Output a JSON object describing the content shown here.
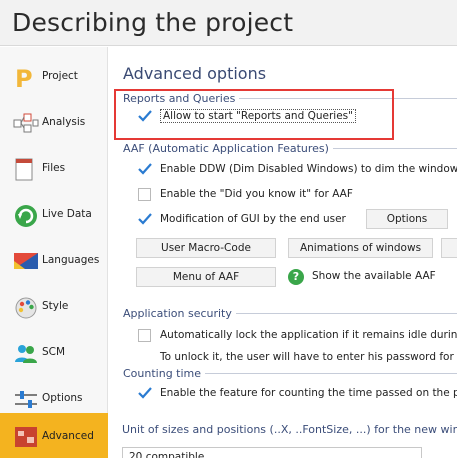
{
  "window": {
    "title": "Describing the project"
  },
  "sidebar": {
    "items": [
      {
        "label": "Project",
        "icon": "project-p-icon",
        "active": false
      },
      {
        "label": "Analysis",
        "icon": "analysis-icon",
        "active": false
      },
      {
        "label": "Files",
        "icon": "files-icon",
        "active": false
      },
      {
        "label": "Live Data",
        "icon": "live-data-icon",
        "active": false
      },
      {
        "label": "Languages",
        "icon": "languages-flag-icon",
        "active": false
      },
      {
        "label": "Style",
        "icon": "style-palette-icon",
        "active": false
      },
      {
        "label": "SCM",
        "icon": "scm-users-icon",
        "active": false
      },
      {
        "label": "Options",
        "icon": "options-sliders-icon",
        "active": false
      },
      {
        "label": "Advanced",
        "icon": "advanced-icon",
        "active": true
      }
    ]
  },
  "main": {
    "heading": "Advanced options",
    "reports": {
      "title": "Reports and Queries",
      "allow_label": "Allow to start \"Reports and Queries\"",
      "allow_checked": true
    },
    "aaf": {
      "title": "AAF (Automatic Application Features)",
      "ddw_label": "Enable DDW (Dim Disabled Windows) to dim  the windows when",
      "ddw_checked": true,
      "did_you_know_label": "Enable the \"Did you know it\" for AAF",
      "did_you_know_checked": false,
      "gui_mod_label": "Modification of GUI by the end user",
      "gui_mod_checked": true,
      "options_button": "Options",
      "user_macro_button": "User Macro-Code",
      "animations_button": "Animations of windows",
      "menu_aaf_button": "Menu of AAF",
      "show_aaf_button": "Show the available AAF"
    },
    "security": {
      "title": "Application security",
      "auto_lock_label": "Automatically lock the application if it remains idle during:",
      "auto_lock_checked": false,
      "unlock_text": "To unlock it, the user will have to enter his password for open"
    },
    "counting": {
      "title": "Counting time",
      "enable_label": "Enable the feature for counting the time passed on the projec",
      "enable_checked": true
    },
    "units": {
      "label": "Unit of sizes and positions (..X, ..FontSize, ...) for the new win",
      "selected_value": "20 compatible"
    }
  },
  "colors": {
    "accent": "#f4b31f",
    "heading": "#3a4a73",
    "check": "#2a7bd1",
    "highlight": "#e53935",
    "help": "#3aa64a"
  }
}
